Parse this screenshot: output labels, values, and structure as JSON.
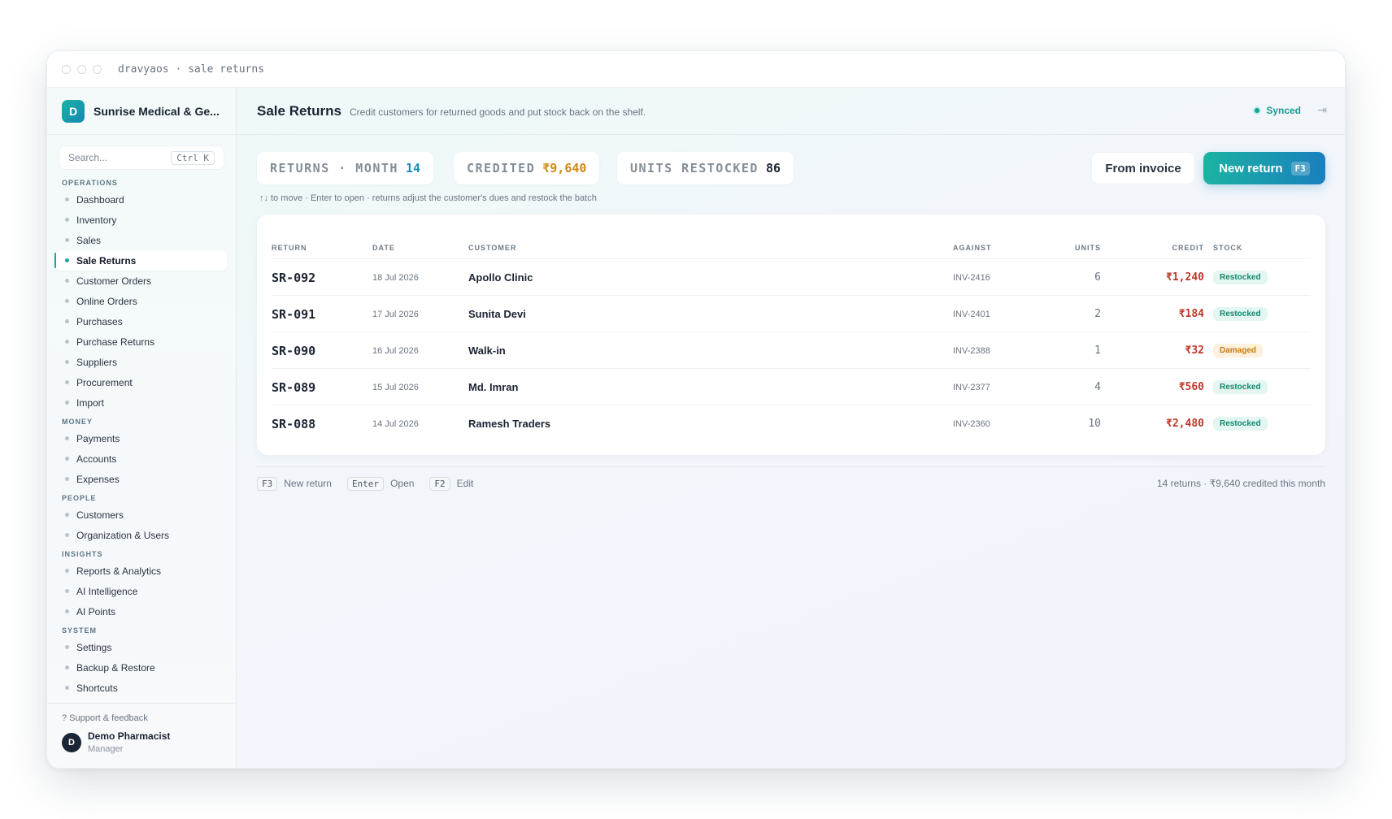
{
  "window": {
    "title": "dravyaos · sale returns"
  },
  "sidebar": {
    "brand_initial": "D",
    "brand_name": "Sunrise Medical & Ge...",
    "search_placeholder": "Search...",
    "search_shortcut": "Ctrl K",
    "sections": [
      {
        "title": "OPERATIONS",
        "items": [
          "Dashboard",
          "Inventory",
          "Sales",
          "Sale Returns",
          "Customer Orders",
          "Online Orders",
          "Purchases",
          "Purchase Returns",
          "Suppliers",
          "Procurement",
          "Import"
        ]
      },
      {
        "title": "MONEY",
        "items": [
          "Payments",
          "Accounts",
          "Expenses"
        ]
      },
      {
        "title": "PEOPLE",
        "items": [
          "Customers",
          "Organization & Users"
        ]
      },
      {
        "title": "INSIGHTS",
        "items": [
          "Reports & Analytics",
          "AI Intelligence",
          "AI Points"
        ]
      },
      {
        "title": "SYSTEM",
        "items": [
          "Settings",
          "Backup & Restore",
          "Shortcuts"
        ]
      }
    ],
    "active_item": "Sale Returns",
    "support": "? Support & feedback",
    "user": {
      "initial": "D",
      "name": "Demo Pharmacist",
      "role": "Manager"
    }
  },
  "header": {
    "title": "Sale Returns",
    "subtitle": "Credit customers for returned goods and put stock back on the shelf.",
    "sync_status": "Synced"
  },
  "stats": [
    {
      "label": "RETURNS · MONTH",
      "value": "14",
      "color": "#1a8fb5"
    },
    {
      "label": "CREDITED",
      "value": "₹9,640",
      "color": "#d08a10"
    },
    {
      "label": "UNITS RESTOCKED",
      "value": "86",
      "color": "#1b2433"
    }
  ],
  "actions": {
    "from_invoice": "From invoice",
    "new_return": "New return",
    "new_return_key": "F3"
  },
  "hint": "↑↓ to move · Enter to open · returns adjust the customer's dues and restock the batch",
  "table": {
    "columns": {
      "return": "RETURN",
      "date": "DATE",
      "customer": "CUSTOMER",
      "against": "AGAINST",
      "units": "UNITS",
      "credit": "CREDIT",
      "stock": "STOCK"
    },
    "rows": [
      {
        "return": "SR-092",
        "date": "18 Jul 2026",
        "customer": "Apollo Clinic",
        "against": "INV-2416",
        "units": "6",
        "credit": "₹1,240",
        "stock": "Restocked"
      },
      {
        "return": "SR-091",
        "date": "17 Jul 2026",
        "customer": "Sunita Devi",
        "against": "INV-2401",
        "units": "2",
        "credit": "₹184",
        "stock": "Restocked"
      },
      {
        "return": "SR-090",
        "date": "16 Jul 2026",
        "customer": "Walk-in",
        "against": "INV-2388",
        "units": "1",
        "credit": "₹32",
        "stock": "Damaged"
      },
      {
        "return": "SR-089",
        "date": "15 Jul 2026",
        "customer": "Md. Imran",
        "against": "INV-2377",
        "units": "4",
        "credit": "₹560",
        "stock": "Restocked"
      },
      {
        "return": "SR-088",
        "date": "14 Jul 2026",
        "customer": "Ramesh Traders",
        "against": "INV-2360",
        "units": "10",
        "credit": "₹2,480",
        "stock": "Restocked"
      }
    ]
  },
  "footer": {
    "shortcuts": [
      {
        "key": "F3",
        "label": "New return"
      },
      {
        "key": "Enter",
        "label": "Open"
      },
      {
        "key": "F2",
        "label": "Edit"
      }
    ],
    "summary": "14 returns · ₹9,640 credited this month"
  }
}
